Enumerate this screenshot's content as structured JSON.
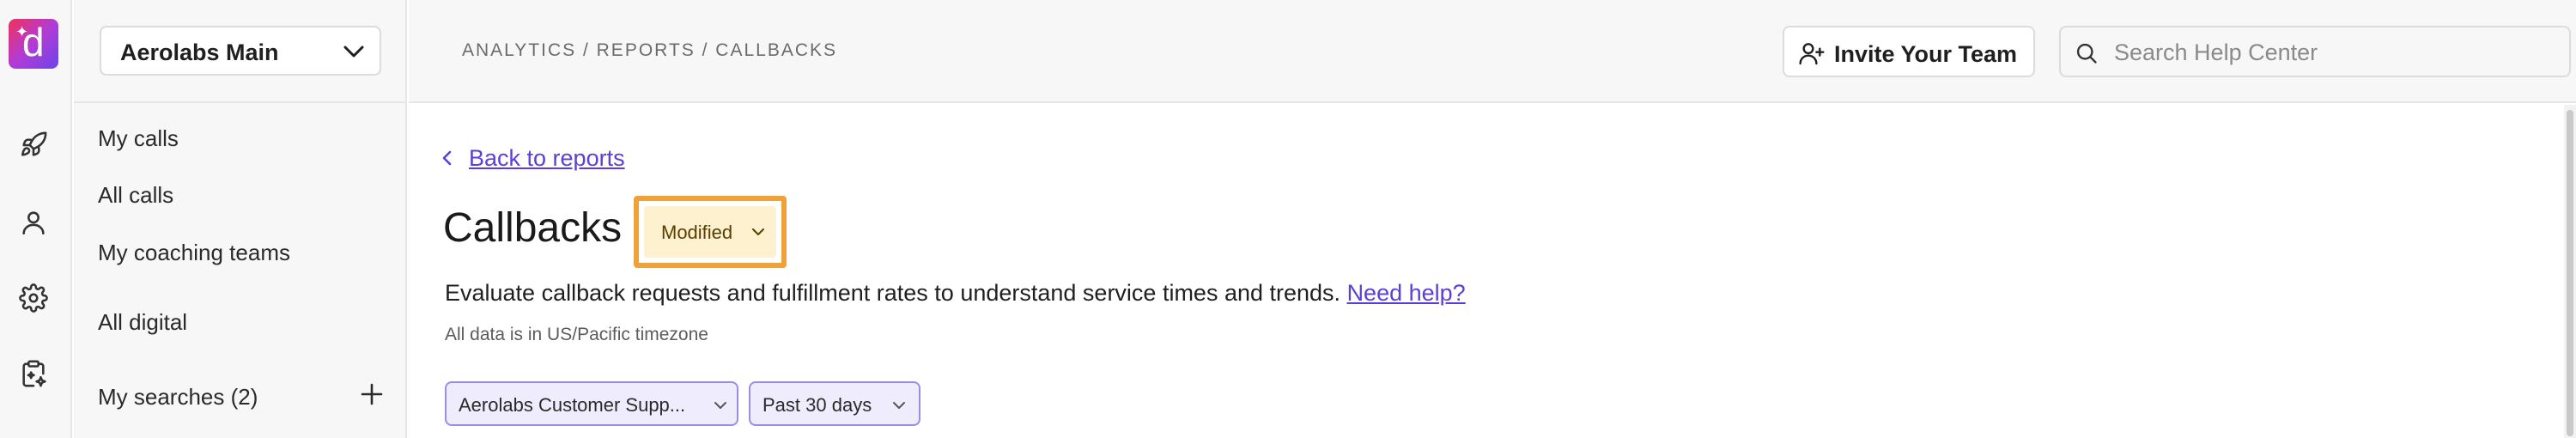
{
  "rail": {
    "logo_letter": "d",
    "icons": [
      "rocket-icon",
      "user-icon",
      "gear-icon",
      "clipboard-sparkle-icon"
    ]
  },
  "sidebar": {
    "workspace": "Aerolabs Main",
    "items": [
      {
        "label": "My calls"
      },
      {
        "label": "All calls"
      },
      {
        "label": "My coaching teams"
      },
      {
        "label": "All digital"
      },
      {
        "label": "My searches (2)"
      }
    ]
  },
  "topbar": {
    "breadcrumb": "ANALYTICS / REPORTS / CALLBACKS",
    "invite_label": "Invite Your Team",
    "search_placeholder": "Search Help Center"
  },
  "main": {
    "back_label": "Back to reports",
    "title": "Callbacks",
    "modified_label": "Modified",
    "description": "Evaluate callback requests and fulfillment rates to understand service times and trends.",
    "help_link": "Need help?",
    "timezone_note": "All data is in US/Pacific timezone",
    "filters": [
      {
        "label": "Aerolabs Customer Supp..."
      },
      {
        "label": "Past 30 days"
      }
    ]
  },
  "colors": {
    "accent": "#5b3fd6",
    "highlight": "#f0a137",
    "badge_bg": "#fdf1cf",
    "chip_bg": "#efedfd"
  }
}
